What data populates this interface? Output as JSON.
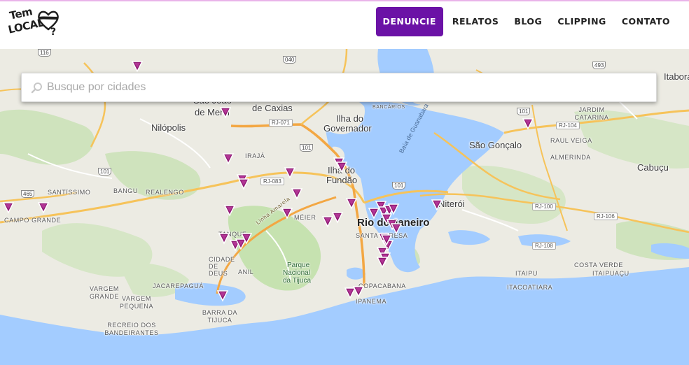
{
  "brand": {
    "logo_line1": "Tem",
    "logo_line2": "LOCAL",
    "logo_heart_mark": "?"
  },
  "nav": [
    {
      "label": "DENUNCIE",
      "primary": true
    },
    {
      "label": "RELATOS"
    },
    {
      "label": "BLOG"
    },
    {
      "label": "CLIPPING"
    },
    {
      "label": "CONTATO"
    }
  ],
  "search": {
    "placeholder": "Busque por cidades",
    "value": ""
  },
  "colors": {
    "accent": "#6b12a6",
    "marker": "#8e1a74",
    "water": "#a3ccff",
    "land": "#ecebe3",
    "highway": "#f6c35a",
    "park": "#c6e2b0"
  },
  "map": {
    "places": {
      "rio": "Rio de Janeiro",
      "sao_joao": "São João",
      "de_meriti": "de Meriti",
      "de_caxias": "de Caxias",
      "nilopolis": "Nilópolis",
      "ilha_gov1": "Ilha do",
      "ilha_gov2": "Governador",
      "ilha_fundao1": "Ilha do",
      "ilha_fundao2": "Fundão",
      "niteroi": "Niterói",
      "sao_goncalo": "São Gonçalo",
      "cabucu": "Cabuçu",
      "itabora": "Itabora",
      "campo_grande": "CAMPO GRANDE",
      "santissimo": "SANTÍSSIMO",
      "bangu": "BANGU",
      "realengo": "REALENGO",
      "iraja": "IRAJÁ",
      "meier": "MÉIER",
      "tanque": "TANQUE",
      "cidade_de_deus": "CIDADE DE DEUS",
      "anil": "ANIL",
      "jacarepagua": "JACAREPAGUÁ",
      "vargem_grande": "VARGEM GRANDE",
      "vargem_pequena": "VARGEM PEQUENA",
      "recreio": "RECREIO DOS BANDEIRANTES",
      "barra": "BARRA DA TIJUCA",
      "santa_teresa": "SANTA TERESA",
      "copacabana": "COPACABANA",
      "ipanema": "IPANEMA",
      "jardim_catarina": "JARDIM CATARINA",
      "raul_veiga": "RAUL VEIGA",
      "almerinda": "ALMERINDA",
      "itaipu": "ITAIPU",
      "costa_verde": "COSTA VERDE",
      "itaipuacu": "ITAIPUAÇU",
      "itacoatiara": "ITACOATIARA",
      "bancarios": "BANCÁRIOS",
      "parque1": "Parque",
      "parque2": "Nacional",
      "parque3": "da Tijuca",
      "baia": "Baía de Guanabara"
    },
    "roads": {
      "r116": "116",
      "r040": "040",
      "r493": "493",
      "r101a": "101",
      "r101b": "101",
      "r101c": "101",
      "r101d": "101",
      "r101e": "101",
      "r465": "465",
      "rj071": "RJ-071",
      "rj083": "RJ-083",
      "rj104": "RJ-104",
      "rj100": "RJ-100",
      "rj106": "RJ-106",
      "rj108": "RJ-108",
      "linha_amarela": "Linha Amarela"
    },
    "marker_count": 38
  }
}
